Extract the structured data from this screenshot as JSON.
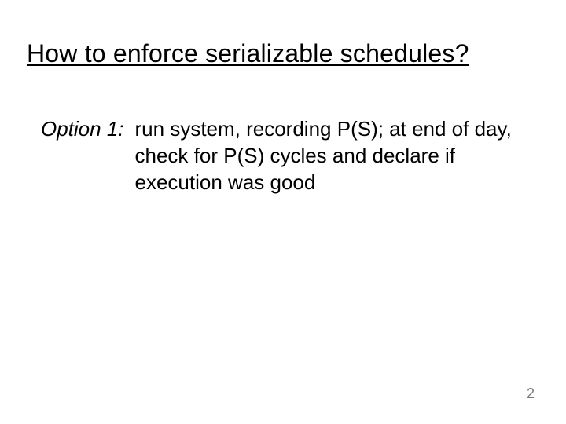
{
  "title": "How to enforce serializable schedules?",
  "option": {
    "label": "Option 1:",
    "text": "run system, recording P(S); at end of day, check for P(S) cycles and declare if execution was good"
  },
  "page_number": "2"
}
